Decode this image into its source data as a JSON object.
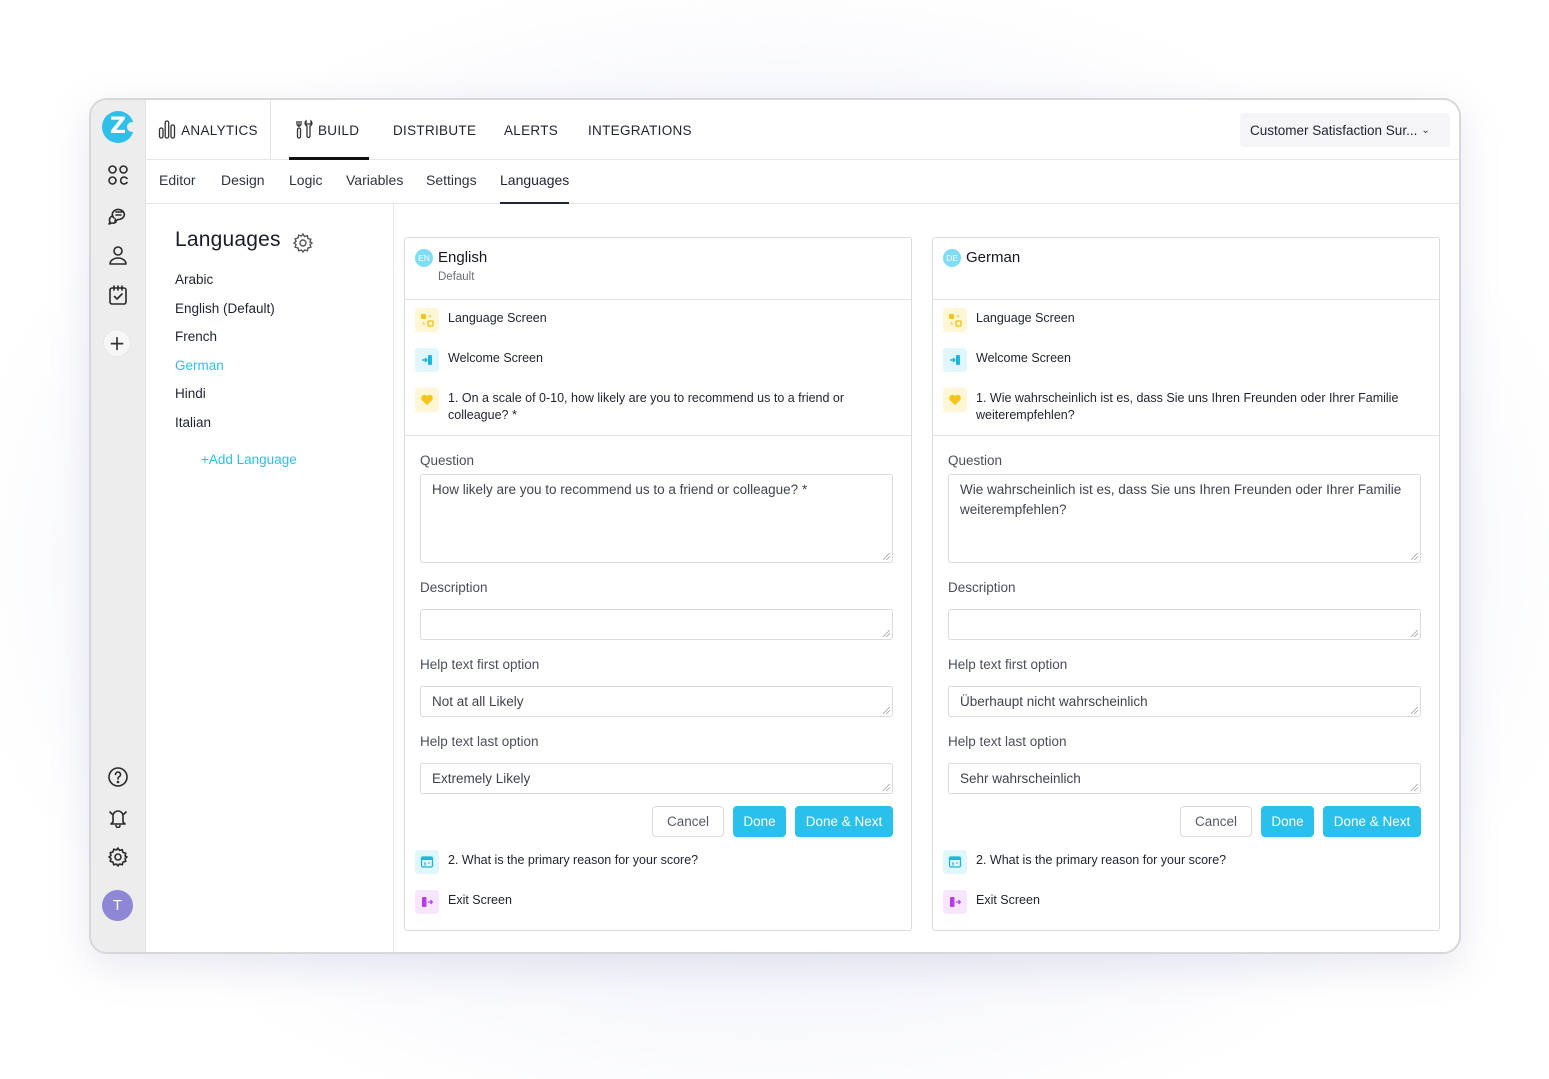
{
  "app": {
    "logo_letter": "Z",
    "avatar_initial": "T"
  },
  "rail": {
    "icons": [
      "apps-grid-icon",
      "chat-bubbles-icon",
      "user-icon",
      "calendar-check-icon",
      "plus-icon"
    ],
    "bottom_icons": [
      "help-icon",
      "bell-icon",
      "settings-icon"
    ]
  },
  "topnav": {
    "items": [
      {
        "label": "ANALYTICS",
        "icon": "analytics-bars-icon"
      },
      {
        "label": "BUILD",
        "icon": "tools-icon",
        "active": true
      },
      {
        "label": "DISTRIBUTE"
      },
      {
        "label": "ALERTS"
      },
      {
        "label": "INTEGRATIONS"
      }
    ],
    "survey_select": {
      "value": "Customer Satisfaction Sur...",
      "icon": "chevron-down-icon"
    }
  },
  "subnav": {
    "tabs": [
      {
        "label": "Editor"
      },
      {
        "label": "Design"
      },
      {
        "label": "Logic"
      },
      {
        "label": "Variables"
      },
      {
        "label": "Settings"
      },
      {
        "label": "Languages",
        "active": true
      }
    ]
  },
  "languages_panel": {
    "title": "Languages",
    "items": [
      "Arabic",
      "English (Default)",
      "French",
      "German",
      "Hindi",
      "Italian"
    ],
    "selected": "German",
    "add_label": "+Add Language"
  },
  "cards": {
    "english": {
      "badge": "EN",
      "title": "English",
      "subtitle": "Default",
      "outline": {
        "language_screen": "Language Screen",
        "welcome_screen": "Welcome Screen",
        "q1": "1. On a scale of 0-10, how likely are you to recommend us to a friend or colleague? *",
        "q2": "2. What is the primary reason for your score?",
        "exit_screen": "Exit Screen"
      },
      "form": {
        "question_label": "Question",
        "question_value": "How likely are you to recommend us to a friend or colleague? *",
        "description_label": "Description",
        "description_value": "",
        "first_label": "Help text first option",
        "first_value": "Not at all Likely",
        "last_label": "Help text last option",
        "last_value": "Extremely Likely"
      },
      "buttons": {
        "cancel": "Cancel",
        "done": "Done",
        "done_next": "Done & Next"
      }
    },
    "german": {
      "badge": "DE",
      "title": "German",
      "subtitle": "",
      "outline": {
        "language_screen": "Language Screen",
        "welcome_screen": "Welcome Screen",
        "q1": "1. Wie wahrscheinlich ist es, dass Sie uns Ihren Freunden oder Ihrer Familie weiterempfehlen?",
        "q2": "2. What is the primary reason for your score?",
        "exit_screen": "Exit Screen"
      },
      "form": {
        "question_label": "Question",
        "question_value": "Wie wahrscheinlich ist es, dass Sie uns Ihren Freunden oder Ihrer Familie weiterempfehlen?",
        "description_label": "Description",
        "description_value": "",
        "first_label": "Help text first option",
        "first_value": "Überhaupt nicht wahrscheinlich",
        "last_label": "Help text last option",
        "last_value": "Sehr wahrscheinlich"
      },
      "buttons": {
        "cancel": "Cancel",
        "done": "Done",
        "done_next": "Done & Next"
      }
    }
  },
  "colors": {
    "accent": "#29c1ec",
    "selected_language": "#2fbfe9",
    "avatar": "#8e87d6",
    "rail_bg": "#ededed"
  }
}
